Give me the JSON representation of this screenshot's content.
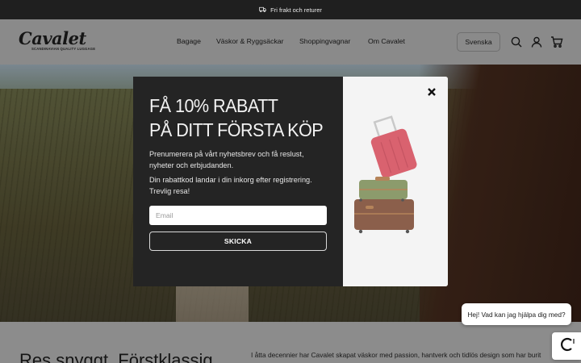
{
  "topbar": {
    "icon": "truck-icon",
    "text": "Fri frakt och returer"
  },
  "header": {
    "logo": {
      "word": "Cavalet",
      "tagline": "SCANDINAVIAN QUALITY LUGGAGE"
    },
    "nav": [
      "Bagage",
      "Väskor & Ryggsäckar",
      "Shoppingvagnar",
      "Om Cavalet"
    ],
    "language": "Svenska",
    "icons": [
      "search-icon",
      "account-icon",
      "cart-icon"
    ]
  },
  "modal": {
    "title_line1": "FÅ 10% RABATT",
    "title_line2": "PÅ DITT FÖRSTA KÖP",
    "paragraph1": "Prenumerera på vårt nyhetsbrev och få reslust, nyheter och erbjudanden.",
    "paragraph2": "Din rabattkod landar i din inkorg efter registrering. Trevlig resa!",
    "email_placeholder": "Email",
    "email_value": "",
    "submit_label": "SKICKA",
    "close_icon": "close-icon"
  },
  "below": {
    "heading": "Res snyggt. Förstklassig",
    "paragraph": "I åtta decennier har Cavalet skapat väskor med passion, hantverk och tidlös design som har burit"
  },
  "chat": {
    "bubble_text": "Hej! Vad kan jag hjälpa dig med?",
    "icon": "chat-logo-icon"
  },
  "colors": {
    "topbar": "#1f1f1f",
    "modal_dark": "#242424",
    "header_overlay": "#8a8a8a",
    "suitcase_pink": "#d65f6e",
    "suitcase_green": "#8b9a6a",
    "suitcase_brown": "#8a5f4a"
  }
}
